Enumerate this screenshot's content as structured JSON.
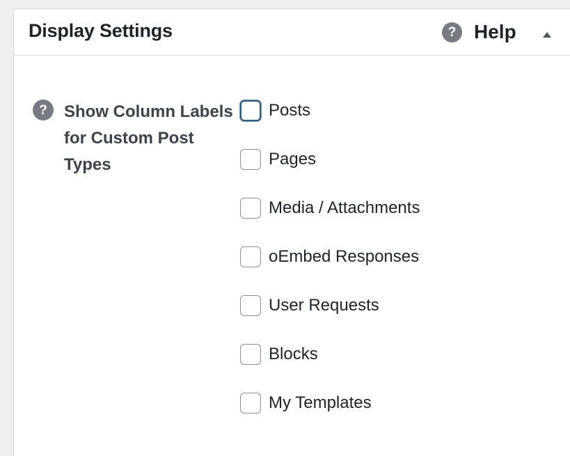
{
  "panel": {
    "title": "Display Settings",
    "help": {
      "icon": "question-circle-icon",
      "icon_glyph": "?",
      "label": "Help",
      "toggle_icon": "caret-up-icon"
    }
  },
  "field": {
    "help_icon": "question-circle-icon",
    "help_icon_glyph": "?",
    "label": "Show Column Labels for Custom Post Types"
  },
  "options": [
    {
      "label": "Posts",
      "checked": false,
      "focused": true
    },
    {
      "label": "Pages",
      "checked": false
    },
    {
      "label": "Media / Attachments",
      "checked": false
    },
    {
      "label": "oEmbed Responses",
      "checked": false
    },
    {
      "label": "User Requests",
      "checked": false
    },
    {
      "label": "Blocks",
      "checked": false
    },
    {
      "label": "My Templates",
      "checked": false
    }
  ],
  "colors": {
    "background": "#f0f0f1",
    "panel": "#ffffff",
    "text": "#1d2327",
    "icon_gray": "#787c82",
    "focus_blue": "#2c5d82"
  }
}
